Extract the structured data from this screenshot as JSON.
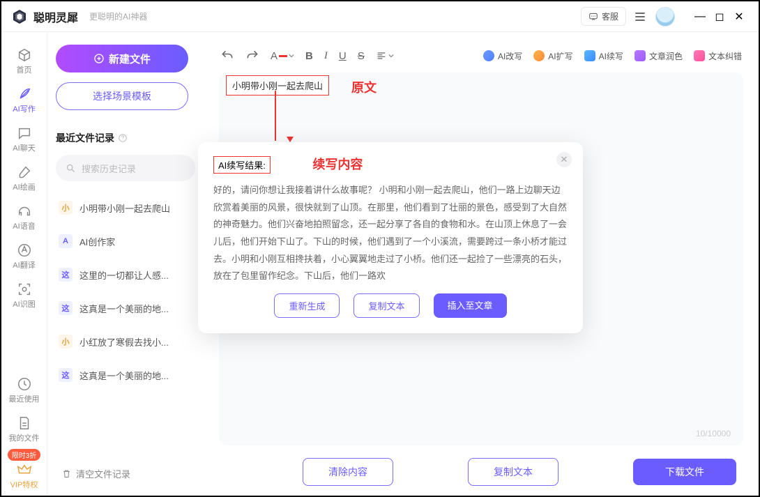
{
  "titlebar": {
    "app_name": "聪明灵犀",
    "app_sub": "更聪明的AI神器",
    "cs_label": "客服"
  },
  "sidenav": {
    "items": [
      {
        "label": "首页"
      },
      {
        "label": "AI写作"
      },
      {
        "label": "AI聊天"
      },
      {
        "label": "AI绘画"
      },
      {
        "label": "AI语音"
      },
      {
        "label": "AI翻译"
      },
      {
        "label": "AI识图"
      }
    ],
    "recent": "最近使用",
    "myfiles": "我的文件",
    "badge": "限时3折",
    "vip": "VIP特权"
  },
  "panel2": {
    "new_file": "新建文件",
    "choose_tpl": "选择场景模板",
    "recent_title": "最近文件记录",
    "search_placeholder": "搜索历史记录",
    "files": [
      {
        "chip": "小",
        "cls": "a",
        "label": "小明带小刚一起去爬山"
      },
      {
        "chip": "A",
        "cls": "b",
        "label": "AI创作家"
      },
      {
        "chip": "这",
        "cls": "b",
        "label": "这里的一切都让人感..."
      },
      {
        "chip": "这",
        "cls": "b",
        "label": "这真是一个美丽的地..."
      },
      {
        "chip": "小",
        "cls": "a",
        "label": "小红放了寒假去找小..."
      },
      {
        "chip": "这",
        "cls": "b",
        "label": "这真是一个美丽的地..."
      }
    ],
    "clear": "清空文件记录"
  },
  "toolbar": {
    "ai_rewrite": "AI改写",
    "ai_expand": "AI扩写",
    "ai_continue": "AI续写",
    "polish": "文章润色",
    "correct": "文本纠错"
  },
  "editor": {
    "original_text": "小明带小刚一起去爬山",
    "ann_orig": "原文",
    "ann_cont": "续写内容",
    "counter": "10/10000"
  },
  "result": {
    "title": "AI续写结果:",
    "body": "好的，请问你想让我接着讲什么故事呢？ 小明和小刚一起去爬山，他们一路上边聊天边欣赏着美丽的风景，很快就到了山顶。在那里，他们看到了壮丽的景色，感受到了大自然的神奇魅力。他们兴奋地拍照留念，还一起分享了各自的食物和水。在山顶上休息了一会儿后，他们开始下山了。下山的时候，他们遇到了一个小溪流，需要跨过一条小桥才能过去。小明和小刚互相搀扶着，小心翼翼地走过了小桥。他们还一起捡了一些漂亮的石头，放在了包里留作纪念。下山后，他们一路欢",
    "regen": "重新生成",
    "copy": "复制文本",
    "insert": "插入至文章"
  },
  "bottom": {
    "clear": "清除内容",
    "copy": "复制文本",
    "download": "下载文件"
  }
}
